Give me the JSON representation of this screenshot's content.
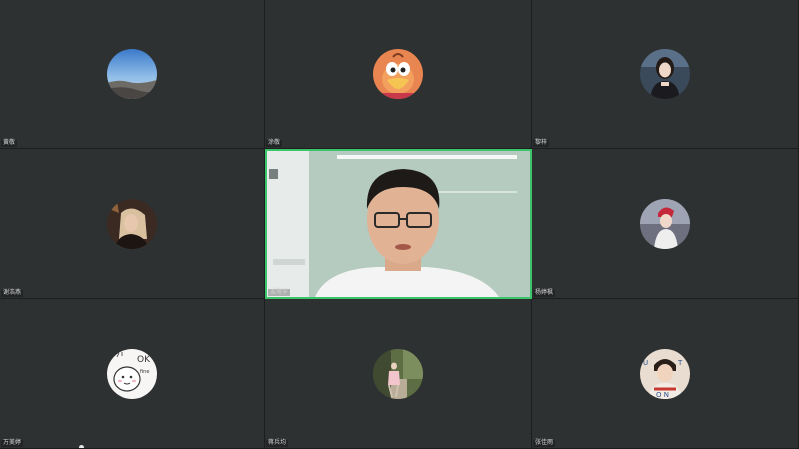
{
  "meeting": {
    "participants": [
      {
        "name": "黄敬",
        "avatar_icon": "mountain-sky-avatar-icon"
      },
      {
        "name": "涂敬",
        "avatar_icon": "cartoon-duck-avatar-icon"
      },
      {
        "name": "黎梓",
        "avatar_icon": "girl-photo-avatar-icon"
      },
      {
        "name": "谢浩燕",
        "avatar_icon": "blonde-girl-avatar-icon"
      },
      {
        "name": "孟常宇",
        "avatar_icon": "webcam-video-icon",
        "video_on": true
      },
      {
        "name": "杨婷枫",
        "avatar_icon": "girl-red-hat-avatar-icon"
      },
      {
        "name": "万美婷",
        "avatar_icon": "ok-cartoon-avatar-icon"
      },
      {
        "name": "蒋兵均",
        "avatar_icon": "street-photo-avatar-icon"
      },
      {
        "name": "张佳雨",
        "avatar_icon": "boy-letters-avatar-icon"
      }
    ],
    "active_speaker_color": "#3cc46a",
    "tile_background": "#2e3132"
  }
}
